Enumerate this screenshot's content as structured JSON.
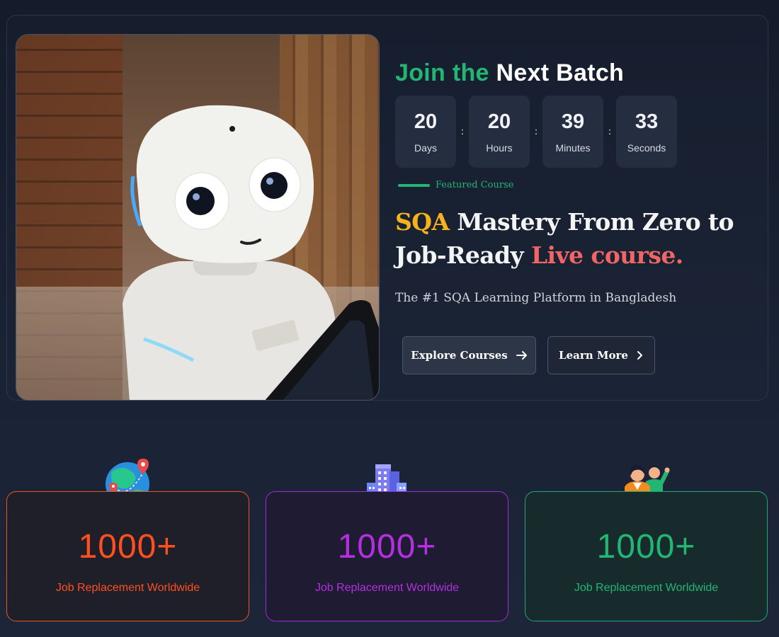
{
  "hero": {
    "join_title_part1": "Join the",
    "join_title_part2": "Next Batch",
    "countdown": [
      {
        "value": "20",
        "label": "Days"
      },
      {
        "value": "20",
        "label": "Hours"
      },
      {
        "value": "39",
        "label": "Minutes"
      },
      {
        "value": "33",
        "label": "Seconds"
      }
    ],
    "separator": ":",
    "featured_label": "Featured Course",
    "headline": {
      "highlight": "SQA",
      "middle": " Mastery From Zero to Job-Ready ",
      "accent": "Live course."
    },
    "subline": "The #1 SQA Learning Platform in Bangladesh",
    "buttons": {
      "explore": "Explore Courses",
      "learn": "Learn More"
    },
    "image_icon": "robot-photo"
  },
  "stats": [
    {
      "value": "1000+",
      "label": "Job Replacement Worldwide",
      "icon": "globe-location-icon",
      "color": "#ff4f1f"
    },
    {
      "value": "1000+",
      "label": "Job Replacement Worldwide",
      "icon": "office-building-icon",
      "color": "#b42fe0"
    },
    {
      "value": "1000+",
      "label": "Job Replacement Worldwide",
      "icon": "people-waving-icon",
      "color": "#22b573"
    }
  ],
  "colors": {
    "background": "#161e2e",
    "green": "#22b573",
    "yellow": "#f6b21b",
    "red": "#f06565"
  }
}
